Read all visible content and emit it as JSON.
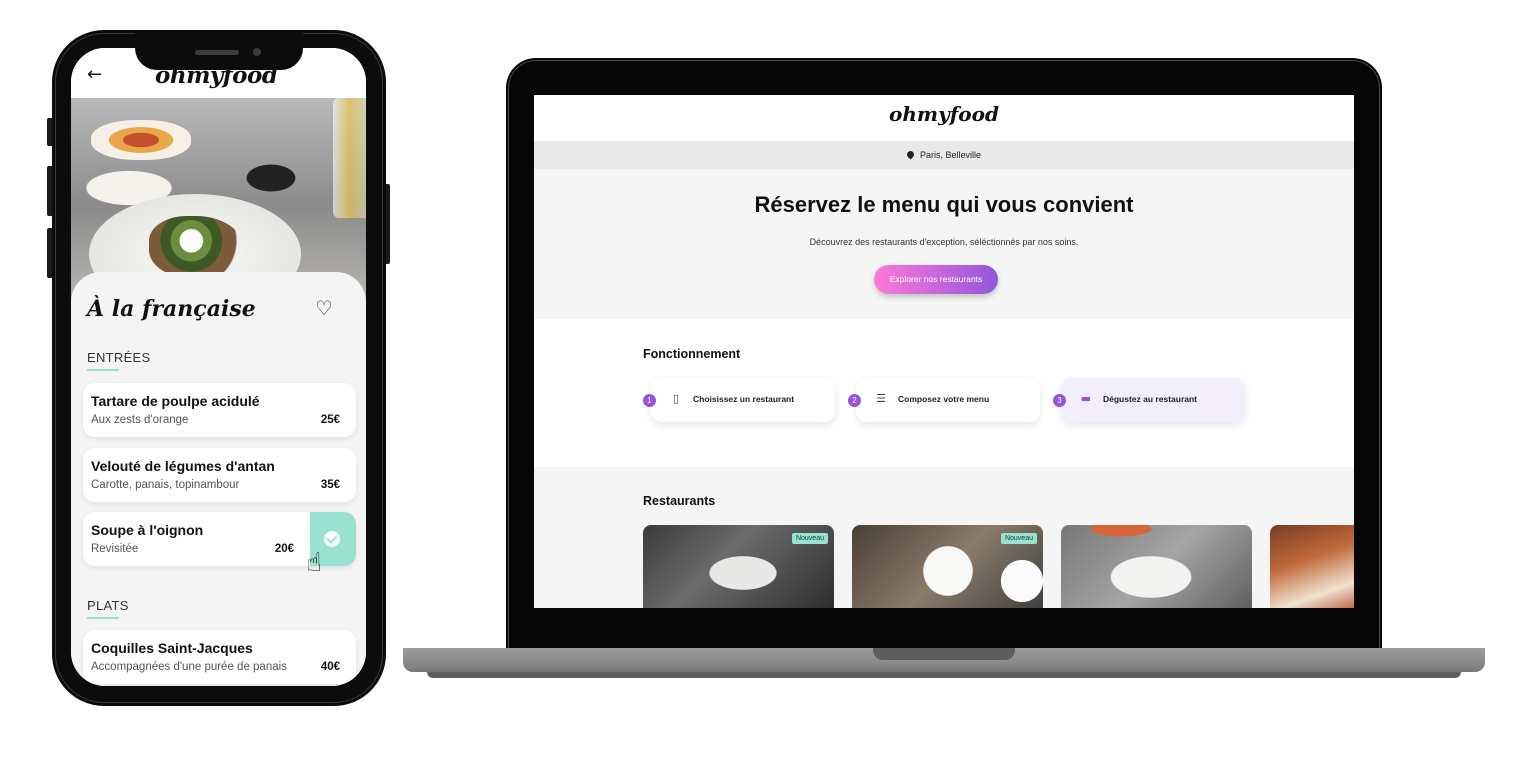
{
  "mobile": {
    "logo": "ohmyfood",
    "back_icon": "arrow-left-icon",
    "menu_title": "À la française",
    "favorite_icon": "heart-outline-icon",
    "sections": [
      {
        "title": "ENTRÉES",
        "items": [
          {
            "name": "Tartare de poulpe acidulé",
            "description": "Aux zests d'orange",
            "price": "25€"
          },
          {
            "name": "Velouté de légumes d'antan",
            "description": "Carotte, panais, topinambour",
            "price": "35€"
          },
          {
            "name": "Soupe à l'oignon",
            "description": "Revisitée",
            "price": "20€",
            "selected": true
          }
        ]
      },
      {
        "title": "PLATS",
        "items": [
          {
            "name": "Coquilles Saint-Jacques",
            "description": "Accompagnées d'une purée de panais",
            "price": "40€"
          }
        ]
      }
    ]
  },
  "desktop": {
    "logo": "ohmyfood",
    "location": "Paris, Belleville",
    "hero_title": "Réservez le menu qui vous convient",
    "hero_subtitle": "Découvrez des restaurants d'exception, séléctionnés par nos soins.",
    "cta_label": "Explorer nos restaurants",
    "steps_title": "Fonctionnement",
    "steps": [
      {
        "number": "1",
        "label": "Choisissez un restaurant",
        "icon": "mobile-phone-icon"
      },
      {
        "number": "2",
        "label": "Composez votre menu",
        "icon": "list-icon"
      },
      {
        "number": "3",
        "label": "Dégustez au restaurant",
        "icon": "store-icon"
      }
    ],
    "restaurants_title": "Restaurants",
    "restaurants": [
      {
        "badge": "Nouveau"
      },
      {
        "badge": "Nouveau"
      },
      {
        "badge": ""
      },
      {
        "badge": ""
      }
    ]
  },
  "colors": {
    "primary": "#9356dc",
    "secondary": "#ff79da",
    "tertiary": "#99e2d0",
    "background": "#f5f5f5"
  }
}
